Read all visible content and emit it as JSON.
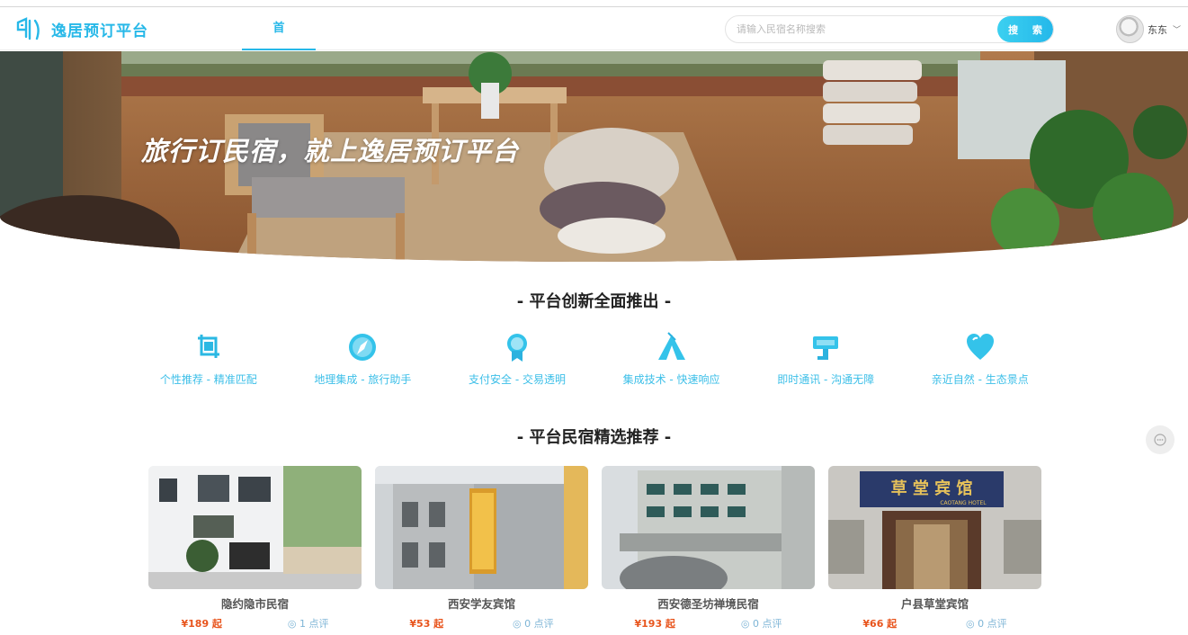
{
  "header": {
    "brand": "逸居预订平台",
    "nav_home": "首页",
    "search_placeholder": "请输入民宿名称搜索",
    "search_button": "搜 索",
    "username": "东东"
  },
  "banner": {
    "slogan": "旅行订民宿，就上逸居预订平台"
  },
  "features_section": {
    "title": "- 平台创新全面推出 -",
    "items": [
      {
        "label": "个性推荐 - 精准匹配",
        "icon": "crop-icon"
      },
      {
        "label": "地理集成 - 旅行助手",
        "icon": "compass-icon"
      },
      {
        "label": "支付安全 - 交易透明",
        "icon": "medal-icon"
      },
      {
        "label": "集成技术 - 快速响应",
        "icon": "tent-icon"
      },
      {
        "label": "即时通讯 - 沟通无障",
        "icon": "paint-roller-icon"
      },
      {
        "label": "亲近自然 - 生态景点",
        "icon": "heart-icon"
      }
    ]
  },
  "recommend_section": {
    "title": "- 平台民宿精选推荐 -",
    "cards": [
      {
        "name": "隐约隐市民宿",
        "price": "¥189 起",
        "reviews": "1 点评"
      },
      {
        "name": "西安学友宾馆",
        "price": "¥53 起",
        "reviews": "0 点评"
      },
      {
        "name": "西安德圣坊禅境民宿",
        "price": "¥193 起",
        "reviews": "0 点评"
      },
      {
        "name": "户县草堂宾馆",
        "price": "¥66 起",
        "reviews": "0 点评",
        "sign": "草 堂 宾 馆",
        "sign_en": "CAOTANG HOTEL"
      }
    ]
  },
  "colors": {
    "accent": "#27b8e8",
    "price": "#e8541c"
  }
}
